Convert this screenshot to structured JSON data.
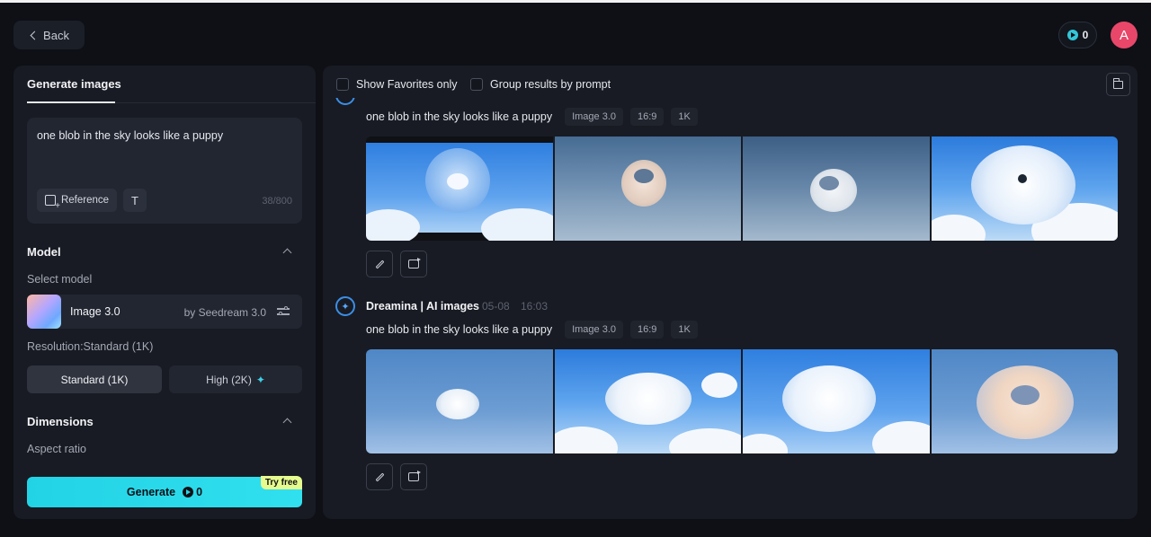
{
  "header": {
    "back_label": "Back",
    "credits": "0",
    "avatar_initial": "A"
  },
  "left_panel": {
    "tab_label": "Generate images",
    "prompt_text": "one blob in the sky looks like a puppy",
    "reference_label": "Reference",
    "char_count": "38/800",
    "model_section": {
      "title": "Model",
      "select_label": "Select model",
      "model_name": "Image 3.0",
      "model_by": "by Seedream 3.0"
    },
    "resolution": {
      "label": "Resolution:Standard (1K)",
      "standard_label": "Standard (1K)",
      "high_label": "High (2K)"
    },
    "dimensions": {
      "title": "Dimensions",
      "aspect_label": "Aspect ratio"
    },
    "generate": {
      "label": "Generate",
      "cost": "0",
      "badge": "Try free"
    }
  },
  "results": {
    "filters": {
      "favorites_label": "Show Favorites only",
      "favorites_checked": false,
      "group_label": "Group results by prompt",
      "group_checked": false
    },
    "groups": [
      {
        "prompt": "one blob in the sky looks like a puppy",
        "tags": [
          "Image 3.0",
          "16:9",
          "1K"
        ]
      },
      {
        "author": "Dreamina | AI images",
        "date": "05-08",
        "time": "16:03",
        "prompt": "one blob in the sky looks like a puppy",
        "tags": [
          "Image 3.0",
          "16:9",
          "1K"
        ]
      }
    ]
  },
  "colors": {
    "accent": "#27d8e8",
    "background": "#0e1016",
    "panel": "#181b23",
    "avatar": "#e8476a",
    "badge": "#e6fb8f"
  }
}
